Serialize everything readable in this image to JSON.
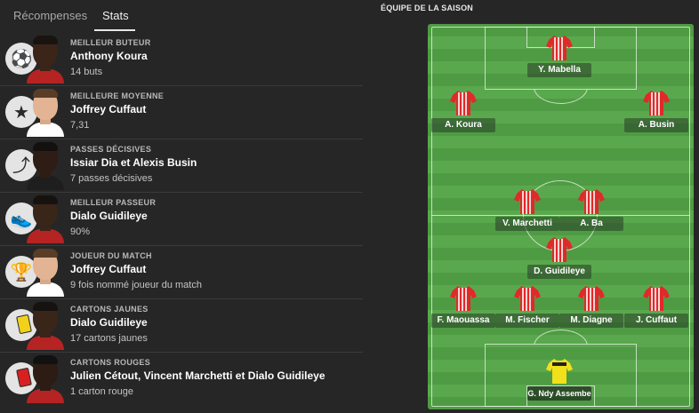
{
  "tabs": {
    "rewards": "Récompenses",
    "stats": "Stats"
  },
  "stats": [
    {
      "category": "MEILLEUR BUTEUR",
      "name": "Anthony Koura",
      "value": "14 buts",
      "icon": "soccer-ball-icon"
    },
    {
      "category": "MEILLEURE MOYENNE",
      "name": "Joffrey Cuffaut",
      "value": "7,31",
      "icon": "star-icon"
    },
    {
      "category": "PASSES DÉCISIVES",
      "name": "Issiar Dia et Alexis Busin",
      "value": "7 passes décisives",
      "icon": "assist-arrow-icon"
    },
    {
      "category": "MEILLEUR PASSEUR",
      "name": "Dialo Guidileye",
      "value": "90%",
      "icon": "shoe-icon"
    },
    {
      "category": "JOUEUR DU MATCH",
      "name": "Joffrey Cuffaut",
      "value": "9 fois nommé joueur du match",
      "icon": "trophy-icon"
    },
    {
      "category": "CARTONS JAUNES",
      "name": "Dialo Guidileye",
      "value": "17 cartons jaunes",
      "icon": "yellow-card-icon"
    },
    {
      "category": "CARTONS ROUGES",
      "name": "Julien Cétout, Vincent Marchetti et Dialo Guidileye",
      "value": "1 carton rouge",
      "icon": "red-card-icon"
    }
  ],
  "team_of_season": {
    "title": "ÉQUIPE DE LA SAISON",
    "players": [
      {
        "name": "Y. Mabella"
      },
      {
        "name": "A. Koura"
      },
      {
        "name": "A. Busin"
      },
      {
        "name": "V. Marchetti"
      },
      {
        "name": "A. Ba"
      },
      {
        "name": "D. Guidileye"
      },
      {
        "name": "F. Maouassa"
      },
      {
        "name": "M. Fischer"
      },
      {
        "name": "M. Diagne"
      },
      {
        "name": "J. Cuffaut"
      },
      {
        "name": "G. Ndy Assembe"
      }
    ]
  },
  "colors": {
    "outfield_shirt": "#e02a2a",
    "goalkeeper_shirt": "#f2e01a",
    "pitch": "#52a046"
  }
}
